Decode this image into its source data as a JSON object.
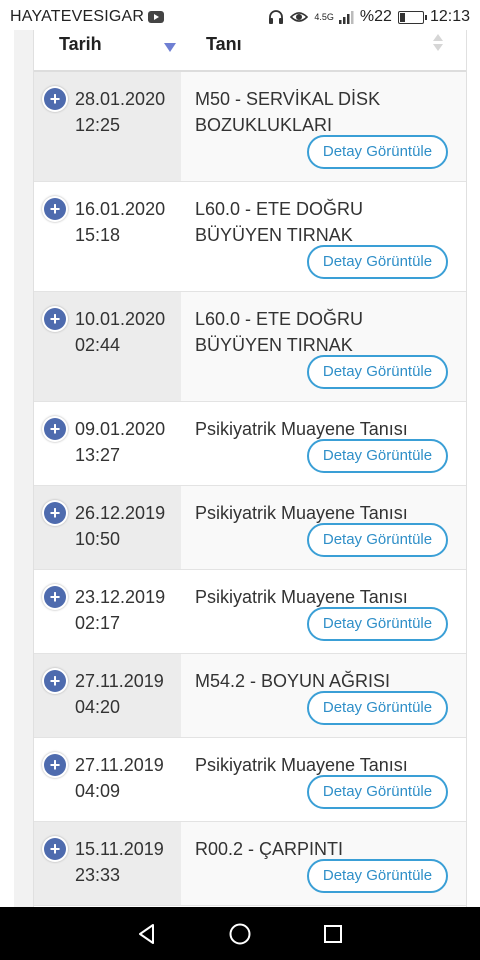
{
  "status_bar": {
    "app_name": "HAYATEVESIGAR",
    "network_small": "4.5G",
    "battery_percent": "%22",
    "battery_level": 0.22,
    "time": "12:13"
  },
  "table": {
    "headers": {
      "date": "Tarih",
      "diagnosis": "Tanı"
    },
    "detail_label": "Detay Görüntüle",
    "rows": [
      {
        "date": "28.01.2020",
        "time": "12:25",
        "diagnosis_line1": "M50 - SERVİKAL DİSK",
        "diagnosis_line2": "BOZUKLUKLARI"
      },
      {
        "date": "16.01.2020",
        "time": "15:18",
        "diagnosis_line1": "L60.0 - ETE DOĞRU",
        "diagnosis_line2": "BÜYÜYEN TIRNAK"
      },
      {
        "date": "10.01.2020",
        "time": "02:44",
        "diagnosis_line1": "L60.0 - ETE DOĞRU",
        "diagnosis_line2": "BÜYÜYEN TIRNAK"
      },
      {
        "date": "09.01.2020",
        "time": "13:27",
        "diagnosis_line1": "Psikiyatrik Muayene Tanısı",
        "diagnosis_line2": ""
      },
      {
        "date": "26.12.2019",
        "time": "10:50",
        "diagnosis_line1": "Psikiyatrik Muayene Tanısı",
        "diagnosis_line2": ""
      },
      {
        "date": "23.12.2019",
        "time": "02:17",
        "diagnosis_line1": "Psikiyatrik Muayene Tanısı",
        "diagnosis_line2": ""
      },
      {
        "date": "27.11.2019",
        "time": "04:20",
        "diagnosis_line1": "M54.2 - BOYUN AĞRISI",
        "diagnosis_line2": ""
      },
      {
        "date": "27.11.2019",
        "time": "04:09",
        "diagnosis_line1": "Psikiyatrik Muayene Tanısı",
        "diagnosis_line2": ""
      },
      {
        "date": "15.11.2019",
        "time": "23:33",
        "diagnosis_line1": "R00.2 - ÇARPINTI",
        "diagnosis_line2": ""
      }
    ]
  }
}
